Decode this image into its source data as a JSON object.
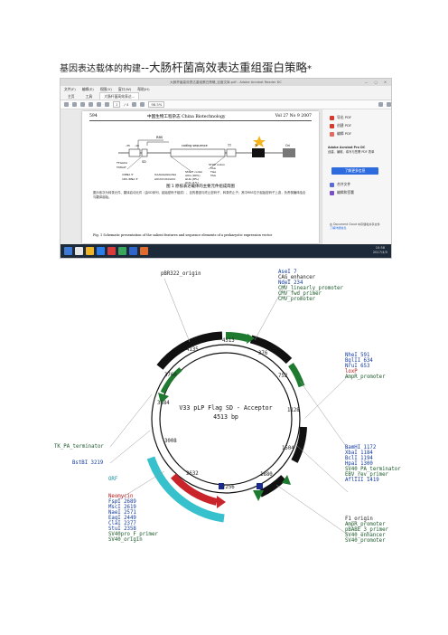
{
  "doc": {
    "title_prefix": "基因表达载体的构建",
    "title_main": "--大肠杆菌高效表达重组蛋白策略",
    "title_mark": "*"
  },
  "window": {
    "title": "大肠杆菌高效表达重组蛋白策略_百度文库.pdf - Adobe Acrobat Reader DC",
    "menu": [
      "文件(F)",
      "编辑(E)",
      "视图(V)",
      "窗口(W)",
      "帮助(H)"
    ],
    "tabs": [
      "主页",
      "工具",
      "大肠杆菌高效表达..."
    ],
    "page_current": "1",
    "page_total": "/ 4",
    "zoom": "98.5%"
  },
  "page": {
    "page_number": "594",
    "journal": "中国生物工程杂志  China Biotechnology",
    "volume": "Vol 27 No 9 2007",
    "figure_caption": "图 1  原核表达载体的主要元件组成简图",
    "paragraph": "图示依次为转录元件、翻译启动元件（由SD序列、起始密码子组成）、目的基因与终止密码子、转录终止子；其中RBS位于起始密码子上游，负责核糖体结合与翻译起始。",
    "figure_caption_en": "Fig. 1  Schematic presentation of the salient features and sequence elements of a prokaryotic expression vector"
  },
  "diagram": {
    "labels": {
      "rbs": "RBS",
      "sd": "SD",
      "coding": "coding sequence",
      "tt": "TT",
      "tr": "Tr",
      "ori": "Ori",
      "stop": "STOP codon",
      "start": "START codon",
      "taa": "TAA",
      "tga": "TGA",
      "tag": "TAG",
      "aug": "AUG (90%)",
      "gug": "GUG (8%)",
      "uug": "UUG (1%)",
      "mrna": "mRNA 5'",
      "rrna": "16S rRNA 3'",
      "seq1": "UAAGGAGGUGA",
      "seq2": "AUUCCUCCACU",
      "p1": "-35",
      "p2": "-10",
      "p3": "TTGACA",
      "p4": "TATAAT"
    }
  },
  "sidepane": {
    "items": [
      "导出 PDF",
      "创建 PDF",
      "编辑 PDF"
    ],
    "promo_title": "Adobe Acrobat Pro DC",
    "promo_text": "创建、编辑、填写与签署 PDF 表单",
    "promo_button": "了解更多信息",
    "items2": [
      "合并文件",
      "编辑和签署"
    ],
    "note": "在 Document Cloud 中存储和共享文件",
    "note_link": "了解详细信息"
  },
  "taskbar": {
    "time": "10:58",
    "date": "2017/4/5"
  },
  "plasmid": {
    "title": "V33 pLP Flag SD - Acceptor",
    "size": "4513 bp",
    "labels": {
      "pbr322": "pBR322_origin",
      "asei": "AseI 7",
      "cag": "CAG_enhancer",
      "ndei": "NdeI 234",
      "cmv_lp": "CMV_linearly_promoter",
      "cmv_fwd": "CMV_fwd_primer",
      "cmv_pr": "CMV_promoter",
      "nhei": "NheI 591",
      "bglii": "BglII 634",
      "nrui": "NruI 653",
      "loxp": "loxP",
      "ampr": "AmpR_promoter",
      "tk": "TK_PA_terminator",
      "bstbi": "BstBI 3219",
      "bamhi": "BamHI 1172",
      "xbai": "XbaI 1184",
      "bcli": "BclI 1194",
      "hpai": "HpaI 1300",
      "sv40pa": "SV40_PA_terminator",
      "ebv": "EBV_rev_primer",
      "afliii": "AflIII 1419",
      "orf": "ORF",
      "neomycin": "Neomycin",
      "fspi": "FspI 2689",
      "msci": "MscI 2619",
      "naei": "NaeI 2571",
      "eagi": "EagI 2449",
      "clai": "ClaI 2377",
      "stui": "StuI 2358",
      "sv40pro": "SV40pro_F_primer",
      "sv40ori": "SV40_origin",
      "f1": "F1_origin",
      "ampr2": "AmpR_promoter",
      "pbabe": "pBABE_3_primer",
      "sv40enh": "SV40_enhancer",
      "sv40prom": "SV40_promoter"
    },
    "ticks": [
      "4513",
      "4135",
      "3760",
      "3384",
      "3008",
      "2632",
      "2256",
      "1880",
      "1504",
      "1128",
      "752",
      "376"
    ]
  }
}
